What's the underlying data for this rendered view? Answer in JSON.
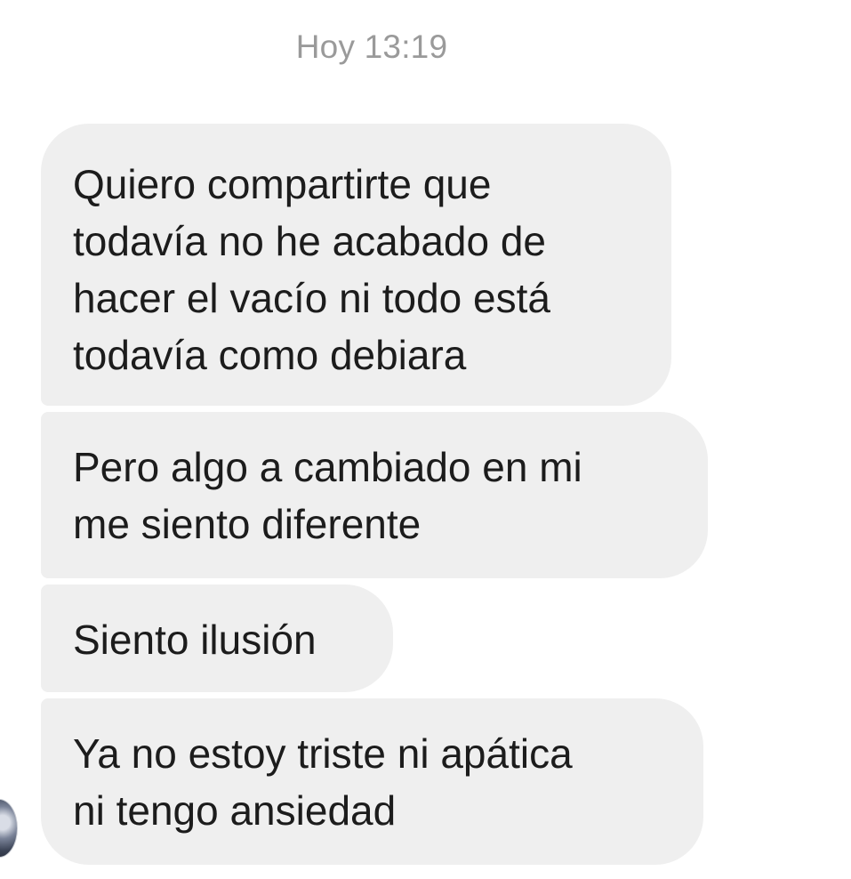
{
  "conversation": {
    "timestamp": "Hoy 13:19",
    "messages": [
      {
        "text": "Quiero compartirte que\ntodavía no he acabado de\nhacer el vacío ni todo está\ntodavía como debiara"
      },
      {
        "text": "Pero algo a cambiado en mi\nme siento diferente"
      },
      {
        "text": "Siento ilusión"
      },
      {
        "text": "Ya no estoy triste ni apática\nni tengo ansiedad"
      }
    ],
    "sender_avatar_icon": "user-avatar-photo",
    "bubble_color": "#efefef",
    "text_color": "#1c1c1c",
    "timestamp_color": "#9a9a9a"
  }
}
